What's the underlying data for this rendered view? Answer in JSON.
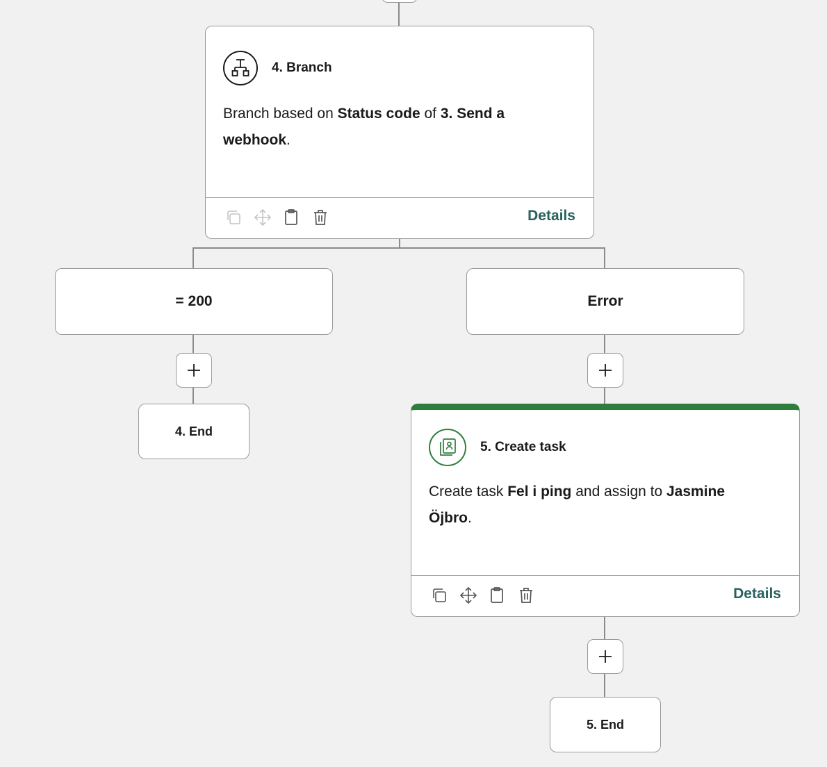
{
  "branch_step": {
    "title": "4. Branch",
    "icon": "branch-icon",
    "desc_prefix": "Branch based on ",
    "desc_field": "Status code",
    "desc_of": " of ",
    "desc_source_a": "3. Send a",
    "desc_source_b": "webhook",
    "desc_end": ".",
    "details_label": "Details"
  },
  "branches": [
    {
      "label": "= 200"
    },
    {
      "label": "Error"
    }
  ],
  "end_left": {
    "label": "4. End"
  },
  "task_step": {
    "title": "5. Create task",
    "icon": "task-icon",
    "accent_color": "#2e7d3c",
    "desc_prefix": "Create task ",
    "desc_task": "Fel i ping",
    "desc_mid": " and assign to ",
    "desc_assignee_a": "Jasmine",
    "desc_assignee_b": "Öjbro",
    "desc_end": ".",
    "details_label": "Details"
  },
  "end_right": {
    "label": "5. End"
  },
  "colors": {
    "background": "#f1f1f1",
    "connector": "#8a8a8a",
    "details_link": "#27625f"
  }
}
